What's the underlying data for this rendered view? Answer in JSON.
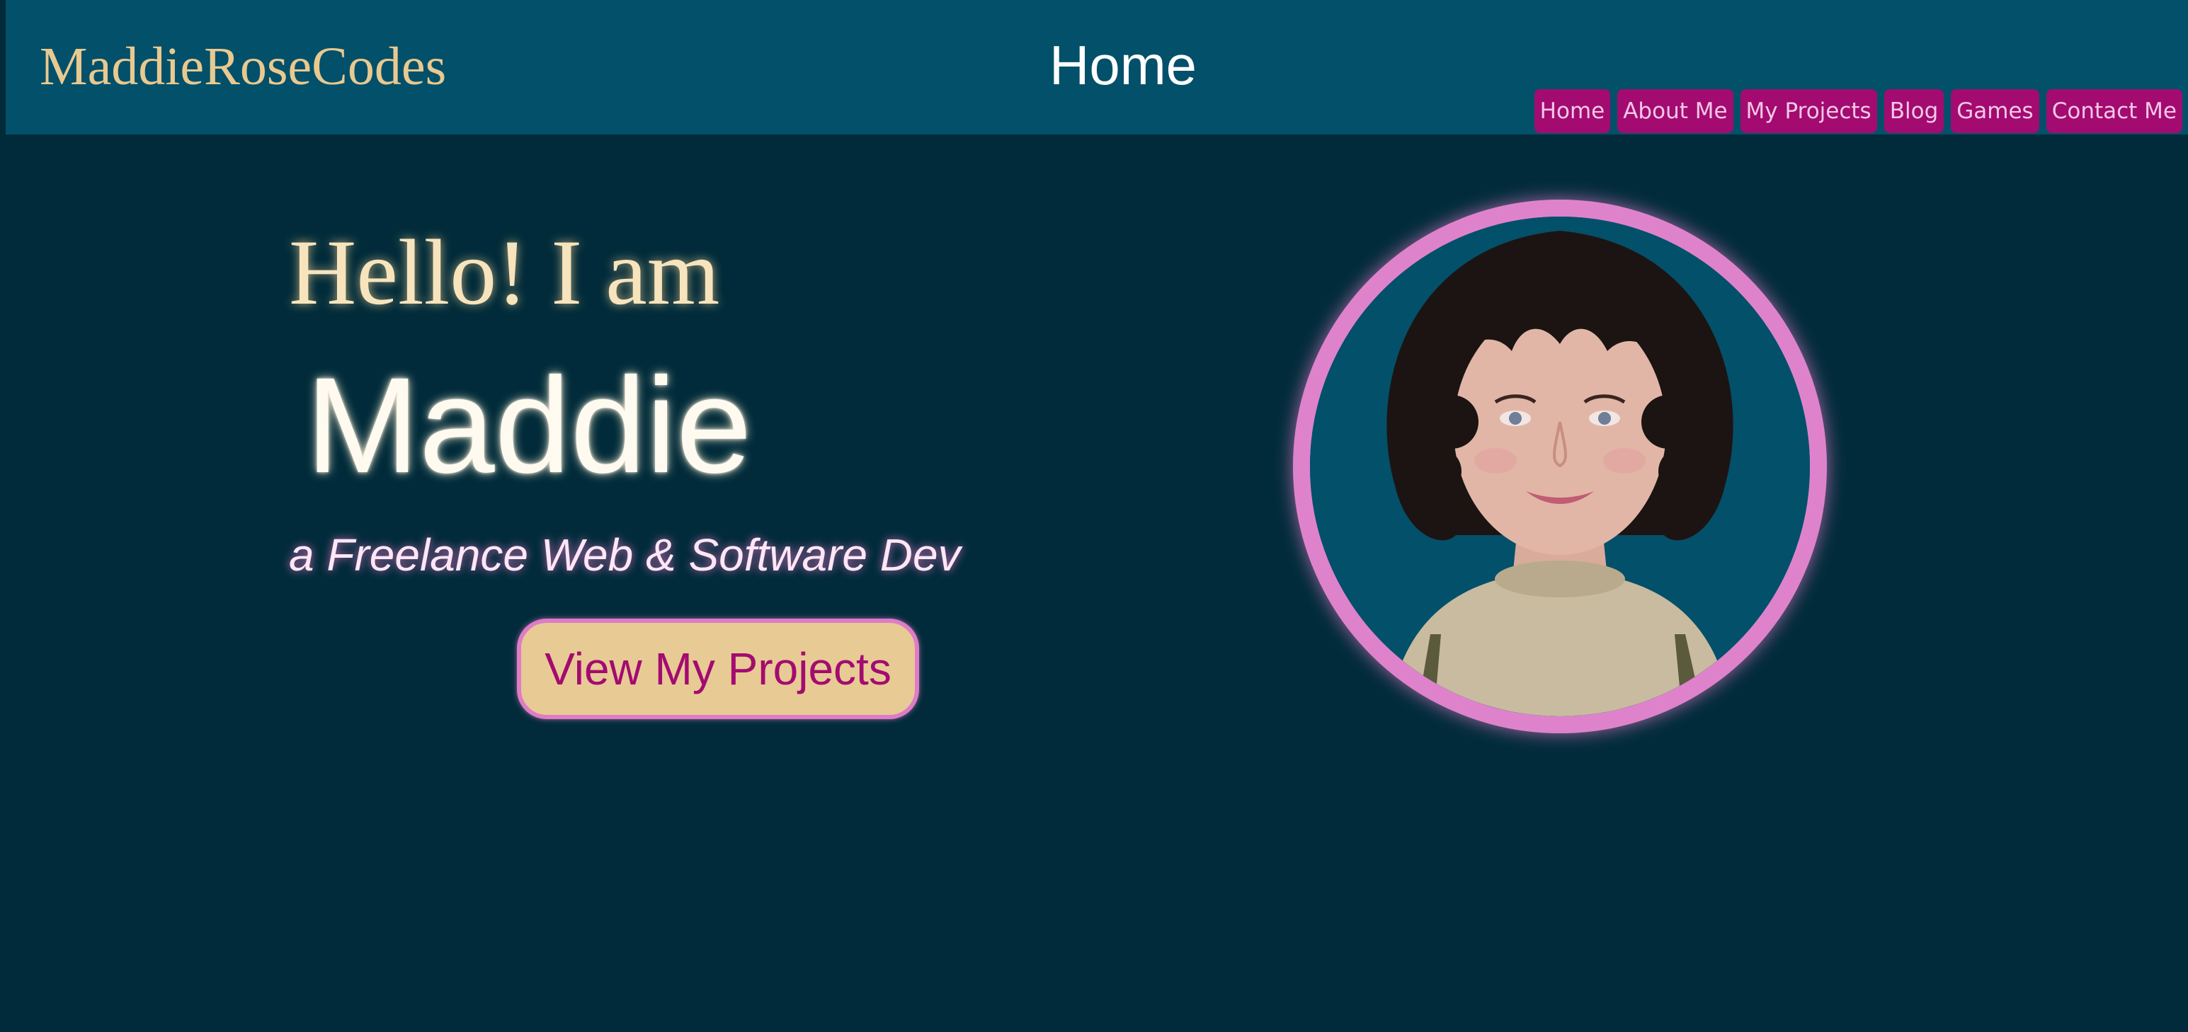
{
  "header": {
    "brand": "MaddieRoseCodes",
    "page_title": "Home",
    "nav": [
      {
        "label": "Home"
      },
      {
        "label": "About Me"
      },
      {
        "label": "My Projects"
      },
      {
        "label": "Blog"
      },
      {
        "label": "Games"
      },
      {
        "label": "Contact Me"
      }
    ]
  },
  "hero": {
    "greeting": "Hello! I am",
    "name": "Maddie",
    "tagline": "a Freelance Web & Software Dev",
    "cta_label": "View My Projects"
  },
  "portrait": {
    "icon": "profile-photo"
  },
  "colors": {
    "background": "#012b3a",
    "header": "#03506a",
    "accent_magenta": "#a30b70",
    "accent_pink": "#de83cb",
    "accent_gold": "#e9c98f"
  }
}
